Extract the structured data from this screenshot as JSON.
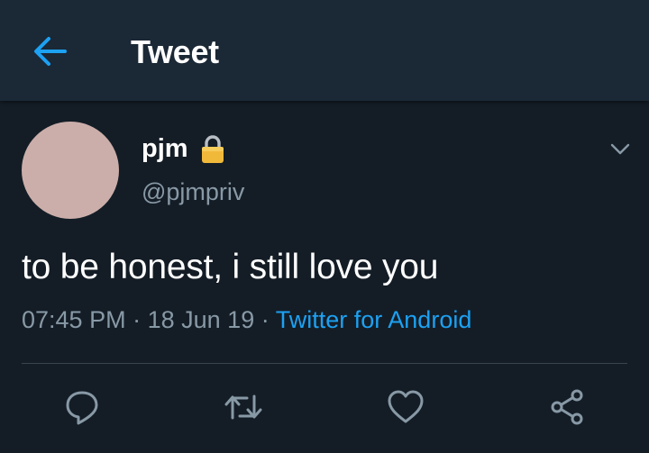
{
  "header": {
    "title": "Tweet",
    "back_icon": "arrow-left-icon"
  },
  "tweet": {
    "author": {
      "display_name": "pjm",
      "handle": "@pjmpriv",
      "protected_icon": "lock-icon"
    },
    "text": "to be honest, i still love you",
    "time": "07:45 PM",
    "date": "18 Jun 19",
    "separator": "·",
    "source": "Twitter for Android"
  },
  "actions": {
    "icons": [
      "reply-icon",
      "retweet-icon",
      "like-icon",
      "share-icon"
    ]
  },
  "colors": {
    "background": "#141d26",
    "header_background": "#1b2836",
    "accent": "#1da1f2",
    "secondary_text": "#8899a6",
    "avatar": "#cbaeaa"
  }
}
